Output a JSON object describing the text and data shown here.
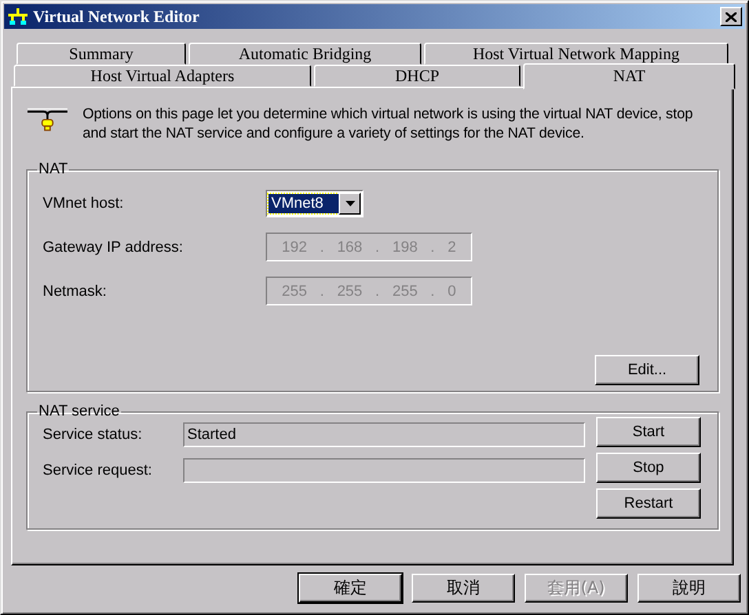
{
  "window": {
    "title": "Virtual Network Editor"
  },
  "tab_rows": [
    [
      {
        "label": "Summary",
        "selected": false
      },
      {
        "label": "Automatic Bridging",
        "selected": false
      },
      {
        "label": "Host Virtual Network Mapping",
        "selected": false
      }
    ],
    [
      {
        "label": "Host Virtual Adapters",
        "selected": false
      },
      {
        "label": "DHCP",
        "selected": false
      },
      {
        "label": "NAT",
        "selected": true
      }
    ]
  ],
  "description": "Options on this page let you determine which virtual network is using the virtual NAT device, stop and start the NAT service and configure a variety of settings for the NAT device.",
  "nat_group": {
    "title": "NAT",
    "vmnet_host": {
      "label": "VMnet host:",
      "value": "VMnet8"
    },
    "fields": [
      {
        "label": "Gateway IP address:",
        "parts": [
          "192",
          ".",
          "168",
          ".",
          "198",
          ".",
          "2"
        ],
        "disabled": true
      },
      {
        "label": "Netmask:",
        "parts": [
          "255",
          ".",
          "255",
          ".",
          "255",
          ".",
          "0"
        ],
        "disabled": true
      }
    ],
    "edit_button": "Edit..."
  },
  "service_group": {
    "title": "NAT service",
    "rows": [
      {
        "label": "Service status:",
        "value": "Started"
      },
      {
        "label": "Service request:"
      }
    ],
    "buttons": [
      "Start",
      "Stop",
      "Restart"
    ]
  },
  "dialog_buttons": [
    {
      "label": "確定",
      "default": true,
      "disabled": false
    },
    {
      "label": "取消",
      "default": false,
      "disabled": false
    },
    {
      "label": "套用(A)",
      "default": false,
      "disabled": true
    },
    {
      "label": "說明",
      "default": false,
      "disabled": false
    }
  ]
}
